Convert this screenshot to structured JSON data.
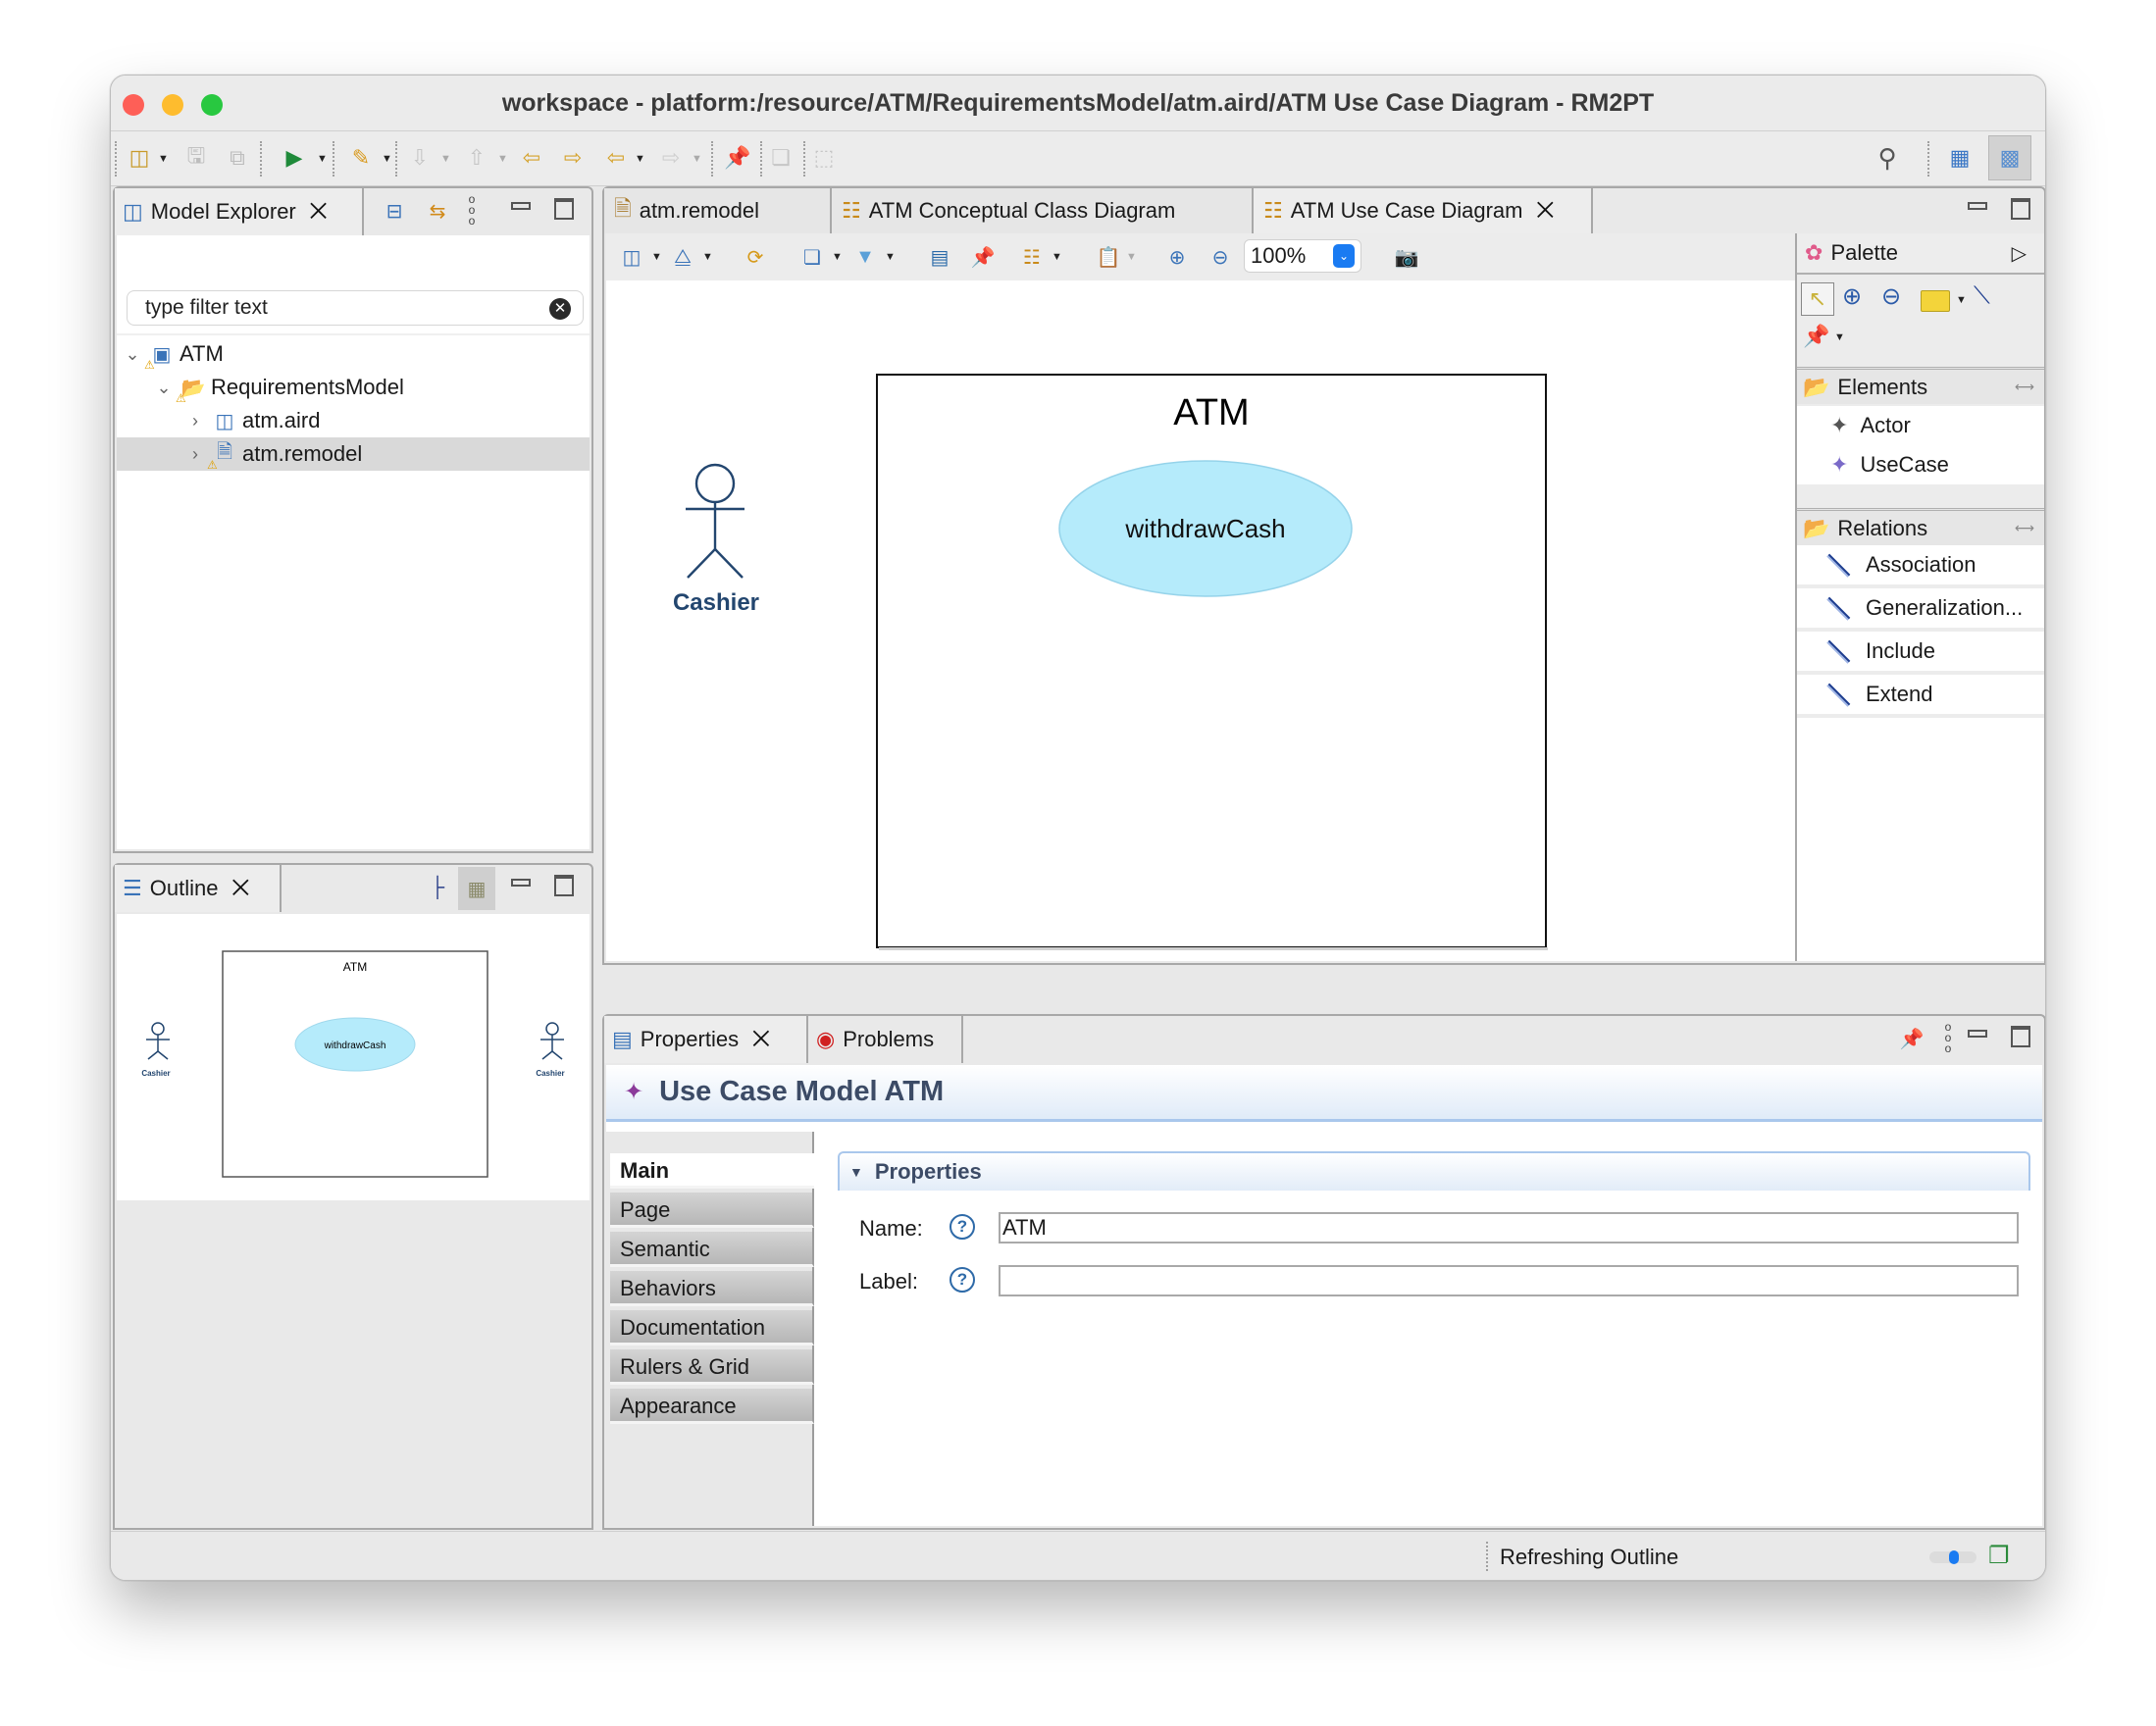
{
  "window": {
    "title": "workspace - platform:/resource/ATM/RequirementsModel/atm.aird/ATM Use Case Diagram - RM2PT",
    "traffic_lights": [
      {
        "name": "close",
        "color": "#fe5f57"
      },
      {
        "name": "minimize",
        "color": "#febc2e"
      },
      {
        "name": "zoom",
        "color": "#28c840"
      }
    ]
  },
  "main_toolbar": {
    "icons": [
      "new-wizard-icon",
      "save-icon",
      "save-all-icon",
      "run-icon",
      "external-tools-icon",
      "next-annotation-icon",
      "previous-annotation-icon",
      "last-edit-back-icon",
      "last-edit-forward-icon",
      "back-icon",
      "forward-icon",
      "pin-editor-icon",
      "compare-icon",
      "toggle-block-icon"
    ],
    "right_icons": [
      "search-icon",
      "open-perspective-icon",
      "modeling-perspective-icon"
    ]
  },
  "model_explorer": {
    "tab_label": "Model Explorer",
    "filter_placeholder": "type filter text",
    "tree": [
      {
        "label": "ATM",
        "level": 0,
        "expanded": true,
        "icon": "modeling-project-icon",
        "warning": true
      },
      {
        "label": "RequirementsModel",
        "level": 1,
        "expanded": true,
        "icon": "folder-icon",
        "warning": true
      },
      {
        "label": "atm.aird",
        "level": 2,
        "expanded": false,
        "icon": "aird-file-icon",
        "warning": false
      },
      {
        "label": "atm.remodel",
        "level": 2,
        "expanded": false,
        "icon": "remodel-file-icon",
        "warning": true,
        "selected": true
      }
    ]
  },
  "outline": {
    "tab_label": "Outline",
    "preview": {
      "system_name": "ATM",
      "use_case": "withdrawCash",
      "actors": [
        "Cashier",
        "Cashier"
      ]
    }
  },
  "editor": {
    "tabs": [
      {
        "label": "atm.remodel",
        "active": false
      },
      {
        "label": "ATM Conceptual Class Diagram",
        "active": false
      },
      {
        "label": "ATM Use Case Diagram",
        "active": true,
        "closable": true
      }
    ],
    "zoom_level": "100%",
    "diagram": {
      "system_boundary": "ATM",
      "use_cases": [
        {
          "label": "withdrawCash",
          "fill": "#b5ebfb"
        }
      ],
      "actors": [
        {
          "label": "Cashier",
          "color": "#23466f"
        }
      ]
    }
  },
  "palette": {
    "title": "Palette",
    "drawers": [
      {
        "label": "Elements",
        "items": [
          "Actor",
          "UseCase"
        ]
      },
      {
        "label": "Relations",
        "items": [
          "Association",
          "Generalization...",
          "Include",
          "Extend"
        ]
      }
    ]
  },
  "properties_view": {
    "tabs": [
      {
        "label": "Properties",
        "active": true
      },
      {
        "label": "Problems",
        "active": false
      }
    ],
    "header": "Use Case Model ATM",
    "side_tabs": [
      "Main",
      "Page",
      "Semantic",
      "Behaviors",
      "Documentation",
      "Rulers & Grid",
      "Appearance"
    ],
    "active_side_tab": "Main",
    "section_title": "Properties",
    "fields": [
      {
        "label": "Name:",
        "value": "ATM"
      },
      {
        "label": "Label:",
        "value": ""
      }
    ]
  },
  "status_bar": {
    "message": "Refreshing Outline"
  }
}
